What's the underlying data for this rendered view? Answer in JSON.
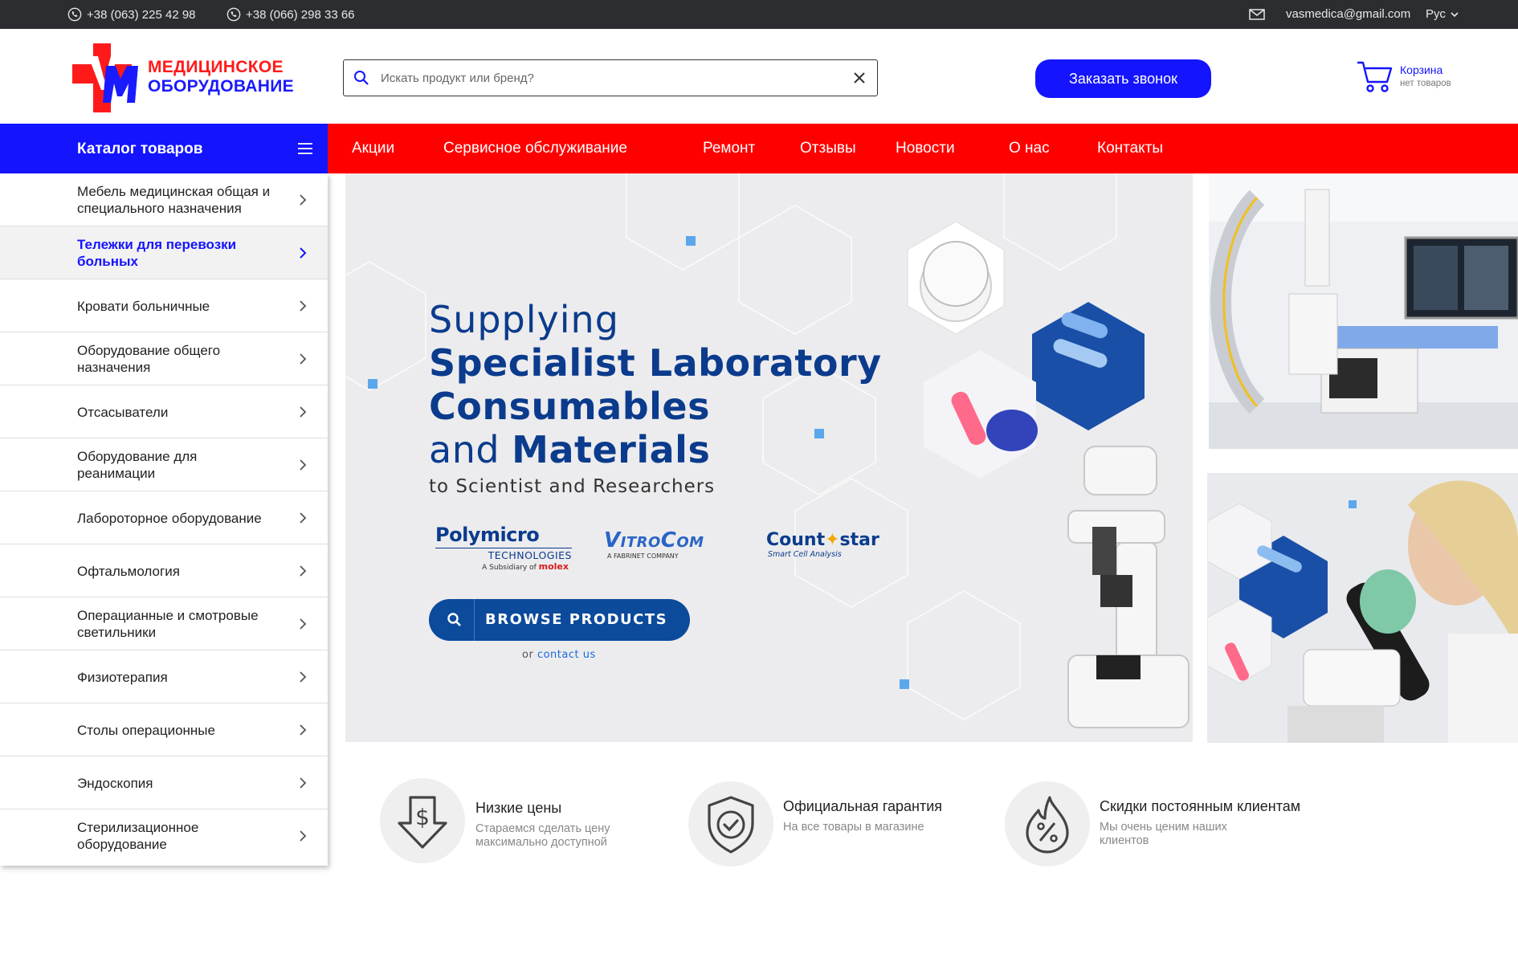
{
  "topbar": {
    "phone1": "+38 (063) 225 42 98",
    "phone2": "+38 (066) 298 33 66",
    "email": "vasmedica@gmail.com",
    "language": "Рус"
  },
  "header": {
    "logo_line1": "МЕДИЦИНСКОЕ",
    "logo_line2": "ОБОРУДОВАНИЕ",
    "search_placeholder": "Искать продукт или бренд?",
    "call_button": "Заказать звонок",
    "cart_label": "Корзина",
    "cart_status": "нет товаров"
  },
  "nav": {
    "catalog_label": "Каталог товаров",
    "items": [
      "Акции",
      "Сервисное обслуживание",
      "Ремонт",
      "Отзывы",
      "Новости",
      "О нас",
      "Контакты"
    ]
  },
  "sidebar": {
    "items": [
      {
        "label": "Мебель медицинская  общая и специального назначения",
        "active": false
      },
      {
        "label": "Тележки для перевозки больных",
        "active": true
      },
      {
        "label": "Кровати больничные",
        "active": false
      },
      {
        "label": "Оборудование общего назначения",
        "active": false
      },
      {
        "label": "Отсасыватели",
        "active": false
      },
      {
        "label": "Оборудование для реанимации",
        "active": false
      },
      {
        "label": "Лабороторное оборудование",
        "active": false
      },
      {
        "label": "Офтальмология",
        "active": false
      },
      {
        "label": "Операцианные и смотровые светильники",
        "active": false
      },
      {
        "label": "Физиотерапия",
        "active": false
      },
      {
        "label": "Столы операционные",
        "active": false
      },
      {
        "label": "Эндоскопия",
        "active": false
      },
      {
        "label": "Стерилизационное оборудование",
        "active": false
      }
    ]
  },
  "hero": {
    "line1": "Supplying",
    "line2a": "Specialist Laboratory",
    "line2b": "Consumables",
    "line3a": "and ",
    "line3b": "Materials",
    "line4": "to Scientist and Researchers",
    "browse_label": "BROWSE PRODUCTS",
    "or_text": "or ",
    "contact_text": "contact us",
    "brand1": "Polymicro",
    "brand1_sub": "TECHNOLOGIES",
    "brand1_sub2a": "A Subsidiary of ",
    "brand1_sub2b": "molex",
    "brand2": "VitroCom",
    "brand2_sub": "A FABRINET COMPANY",
    "brand3a": "Count",
    "brand3b": "star",
    "brand3_sub": "Smart Cell Analysis"
  },
  "features": [
    {
      "title": "Низкие цены",
      "desc": "Стараемся сделать цену максимально доступной",
      "icon": "price-down-icon"
    },
    {
      "title": "Официальная гарантия",
      "desc": "На все товары в магазине",
      "icon": "shield-check-icon"
    },
    {
      "title": "Скидки постоянным клиентам",
      "desc": "Мы очень ценим наших клиентов",
      "icon": "discount-drop-icon"
    }
  ],
  "colors": {
    "brand_blue": "#1414ff",
    "brand_red": "#ff0000",
    "topbar_bg": "#2b2d31",
    "hero_blue": "#0c4a9c"
  }
}
